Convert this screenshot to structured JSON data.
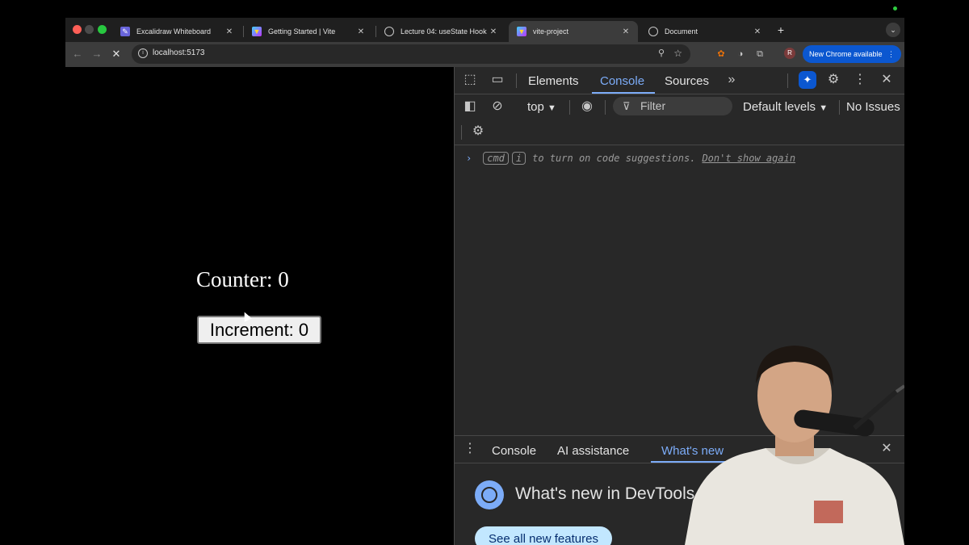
{
  "browser": {
    "tabs": [
      {
        "label": "Excalidraw Whiteboard",
        "icon": "excalidraw-icon"
      },
      {
        "label": "Getting Started | Vite",
        "icon": "vite-icon"
      },
      {
        "label": "Lecture 04: useState Hook",
        "icon": "globe-icon"
      },
      {
        "label": "vite-project",
        "icon": "vite-icon",
        "active": true
      },
      {
        "label": "Document",
        "icon": "globe-icon"
      }
    ],
    "url": "localhost:5173",
    "profile_initial": "R",
    "update_label": "New Chrome available"
  },
  "page": {
    "counter_text": "Counter: 0",
    "button_label": "Increment: 0"
  },
  "devtools": {
    "tabs": [
      "Elements",
      "Console",
      "Sources"
    ],
    "active_tab": "Console",
    "context": "top",
    "filter_placeholder": "Filter",
    "levels": "Default levels",
    "issues": "No Issues",
    "prompt": {
      "key1": "cmd",
      "key2": "i",
      "text": "to turn on code suggestions.",
      "link": "Don't show again"
    },
    "drawer": {
      "tabs": [
        "Console",
        "AI assistance",
        "What's new"
      ],
      "active_tab": "What's new",
      "heading": "What's new in DevTools 14",
      "button": "See all new features"
    }
  },
  "colors": {
    "accent": "#7cacf8",
    "update_pill": "#0b57d0",
    "see_all_bg": "#c2e7ff"
  }
}
